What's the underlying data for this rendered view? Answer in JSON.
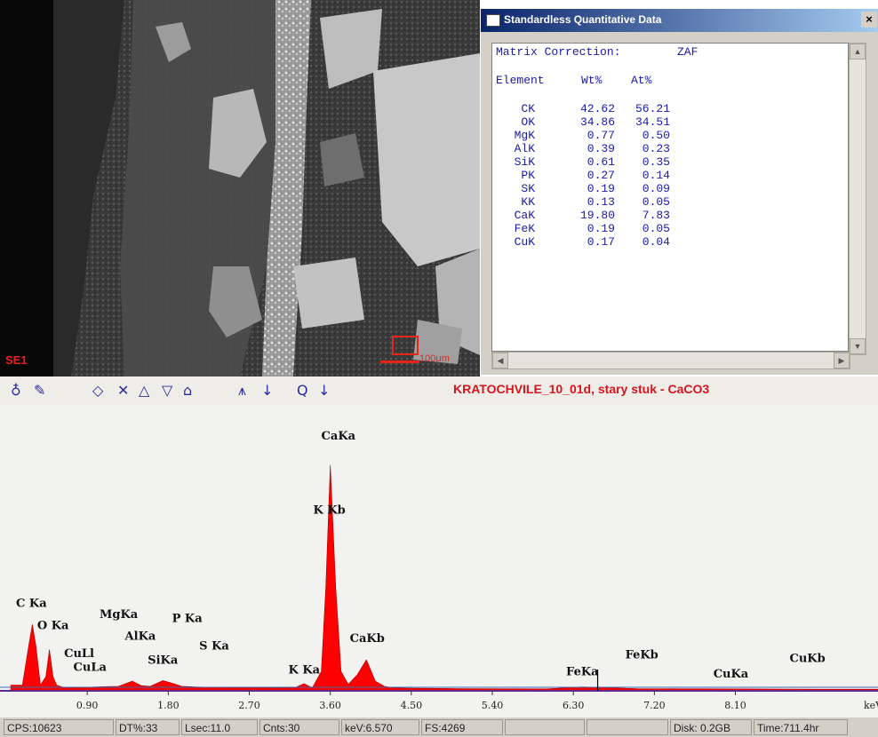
{
  "sem": {
    "detector_label": "SE1",
    "scale_label": "100μm"
  },
  "dialog": {
    "title": "Standardless Quantitative Data",
    "close_glyph": "×",
    "matrix_label": "Matrix Correction:",
    "matrix_value": "ZAF",
    "col_element": "Element",
    "col_wt": "Wt%",
    "col_at": "At%",
    "rows": [
      {
        "el": "CK",
        "wt": "42.62",
        "at": "56.21"
      },
      {
        "el": "OK",
        "wt": "34.86",
        "at": "34.51"
      },
      {
        "el": "MgK",
        "wt": "0.77",
        "at": "0.50"
      },
      {
        "el": "AlK",
        "wt": "0.39",
        "at": "0.23"
      },
      {
        "el": "SiK",
        "wt": "0.61",
        "at": "0.35"
      },
      {
        "el": "PK",
        "wt": "0.27",
        "at": "0.14"
      },
      {
        "el": "SK",
        "wt": "0.19",
        "at": "0.09"
      },
      {
        "el": "KK",
        "wt": "0.13",
        "at": "0.05"
      },
      {
        "el": "CaK",
        "wt": "19.80",
        "at": "7.83"
      },
      {
        "el": "FeK",
        "wt": "0.19",
        "at": "0.05"
      },
      {
        "el": "CuK",
        "wt": "0.17",
        "at": "0.04"
      }
    ]
  },
  "toolbar": {
    "spectrum_title": "KRATOCHVILE_10_01d, stary stuk - CaCO3"
  },
  "status": {
    "cps": "CPS:10623",
    "dt": "DT%:33",
    "lsec": "Lsec:11.0",
    "cnts": "Cnts:30",
    "kev": "keV:6.570",
    "fs": "FS:4269",
    "disk": "Disk: 0.2GB",
    "time": "Time:711.4hr"
  },
  "chart_data": {
    "type": "area",
    "xlabel": "keV",
    "xlim": [
      0,
      10
    ],
    "ylim": [
      0,
      4269
    ],
    "x_ticks": [
      "0.90",
      "1.80",
      "2.70",
      "3.60",
      "4.50",
      "5.40",
      "6.30",
      "7.20",
      "8.10"
    ],
    "fill_color": "#ff0000",
    "series": [
      {
        "x": [
          0.05,
          0.18,
          0.25,
          0.29,
          0.33,
          0.38,
          0.44,
          0.48,
          0.52,
          0.56,
          0.62,
          0.68,
          0.8,
          1.0,
          1.25,
          1.4,
          1.5,
          1.6,
          1.74,
          1.84,
          1.95,
          2.1,
          2.3,
          2.5,
          2.8,
          3.0,
          3.2,
          3.31,
          3.4,
          3.5,
          3.55,
          3.6,
          3.66,
          3.72,
          3.8,
          3.9,
          4.0,
          4.02,
          4.1,
          4.2,
          4.3,
          4.5,
          5.0,
          6.0,
          6.4,
          7.0,
          8.0,
          9.0,
          10.0
        ],
        "y": [
          90,
          90,
          700,
          1030,
          700,
          90,
          220,
          640,
          220,
          90,
          60,
          50,
          50,
          60,
          70,
          150,
          80,
          70,
          160,
          120,
          70,
          60,
          55,
          50,
          50,
          45,
          45,
          110,
          45,
          300,
          1600,
          3500,
          1600,
          300,
          100,
          250,
          480,
          420,
          150,
          70,
          45,
          40,
          35,
          30,
          60,
          35,
          30,
          25,
          25
        ]
      }
    ],
    "annotations": [
      {
        "label": "CaKa",
        "x": 3.69,
        "y": 3900
      },
      {
        "label": "K Kb",
        "x": 3.59,
        "y": 2750
      },
      {
        "label": "C Ka",
        "x": 0.28,
        "y": 1300
      },
      {
        "label": "O Ka",
        "x": 0.52,
        "y": 960
      },
      {
        "label": "MgKa",
        "x": 1.25,
        "y": 1130
      },
      {
        "label": "P Ka",
        "x": 2.01,
        "y": 1070
      },
      {
        "label": "AlKa",
        "x": 1.49,
        "y": 790
      },
      {
        "label": "S Ka",
        "x": 2.31,
        "y": 640
      },
      {
        "label": "CuLl",
        "x": 0.81,
        "y": 520
      },
      {
        "label": "SiKa",
        "x": 1.74,
        "y": 420
      },
      {
        "label": "CuLa",
        "x": 0.93,
        "y": 310
      },
      {
        "label": "CaKb",
        "x": 4.01,
        "y": 760
      },
      {
        "label": "K Ka",
        "x": 3.31,
        "y": 270
      },
      {
        "label": "FeKa",
        "x": 6.4,
        "y": 240
      },
      {
        "label": "FeKb",
        "x": 7.06,
        "y": 500
      },
      {
        "label": "CuKa",
        "x": 8.05,
        "y": 210
      },
      {
        "label": "CuKb",
        "x": 8.9,
        "y": 450
      }
    ]
  }
}
